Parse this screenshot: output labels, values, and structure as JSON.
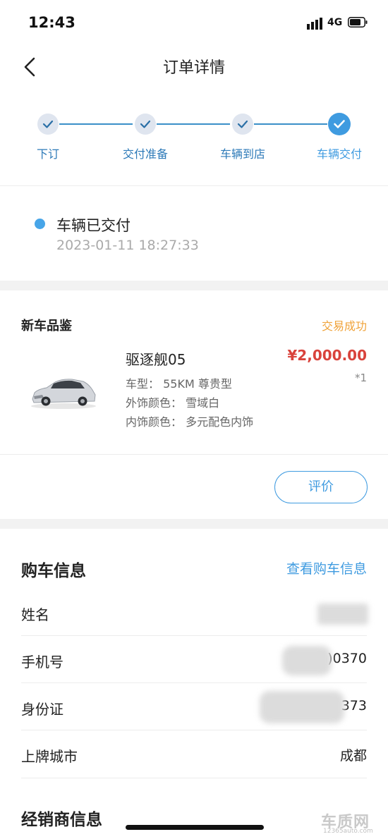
{
  "status_bar": {
    "time": "12:43",
    "network": "4G"
  },
  "nav": {
    "title": "订单详情"
  },
  "steps": [
    {
      "label": "下订"
    },
    {
      "label": "交付准备"
    },
    {
      "label": "车辆到店"
    },
    {
      "label": "车辆交付"
    }
  ],
  "order_status": {
    "text": "车辆已交付",
    "time": "2023-01-11 18:27:33"
  },
  "product": {
    "section_title": "新车品鉴",
    "trade_status": "交易成功",
    "name": "驱逐舰05",
    "price": "¥2,000.00",
    "quantity": "*1",
    "model": "车型：  55KM 尊贵型",
    "exterior": "外饰颜色：  雪域白",
    "interior": "内饰颜色：  多元配色内饰",
    "review_label": "评价"
  },
  "purchase": {
    "title": "购车信息",
    "link": "查看购车信息",
    "rows": [
      {
        "label": "姓名",
        "value": ""
      },
      {
        "label": "手机号",
        "value": "13(       )0370"
      },
      {
        "label": "身份证",
        "value": "5              373"
      },
      {
        "label": "上牌城市",
        "value": "成都"
      }
    ]
  },
  "dealer": {
    "title": "经销商信息"
  },
  "watermark": {
    "brand": "车质网",
    "url": "12365auto.com"
  }
}
